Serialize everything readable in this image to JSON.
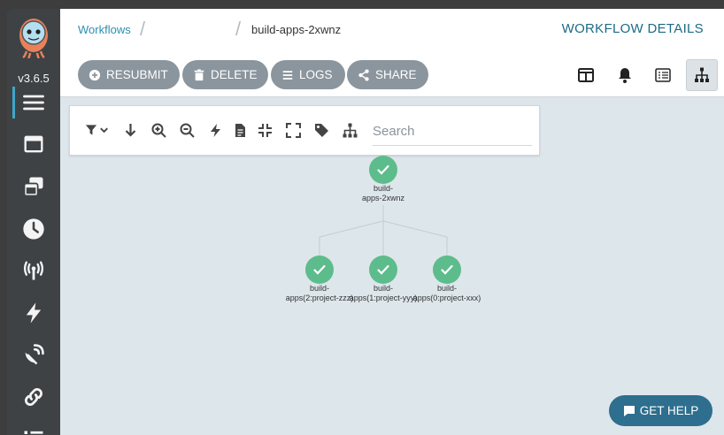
{
  "app": {
    "version": "v3.6.5",
    "brand_color": "#3fa7c9"
  },
  "sidebar": {
    "items": [
      {
        "icon": "menu-icon",
        "active": true
      },
      {
        "icon": "window-icon"
      },
      {
        "icon": "archive-stack-icon"
      },
      {
        "icon": "clock-icon"
      },
      {
        "icon": "antenna-icon"
      },
      {
        "icon": "bolt-icon"
      },
      {
        "icon": "satellite-icon"
      },
      {
        "icon": "link-icon"
      },
      {
        "icon": "list-icon"
      }
    ]
  },
  "header": {
    "breadcrumb_root": "Workflows",
    "breadcrumb_current": "build-apps-2xwnz",
    "title": "WORKFLOW DETAILS"
  },
  "actions": {
    "resubmit": "RESUBMIT",
    "delete": "DELETE",
    "logs": "LOGS",
    "share": "SHARE"
  },
  "views": [
    {
      "icon": "split-panel-icon"
    },
    {
      "icon": "bell-icon"
    },
    {
      "icon": "list-view-icon"
    },
    {
      "icon": "tree-view-icon",
      "active": true
    }
  ],
  "toolbar": {
    "tools": [
      "filter-icon",
      "download-arrow-icon",
      "zoom-in-icon",
      "zoom-out-icon",
      "bolt-icon",
      "document-icon",
      "collapse-icon",
      "expand-icon",
      "tag-icon",
      "hierarchy-icon"
    ],
    "search_placeholder": "Search"
  },
  "graph": {
    "root": {
      "label_1": "build-",
      "label_2": "apps-2xwnz",
      "status": "succeeded"
    },
    "children": [
      {
        "label_1": "build-",
        "label_2": "apps(2:project-zzz)",
        "status": "succeeded"
      },
      {
        "label_1": "build-",
        "label_2": "apps(1:project-yyy)",
        "status": "succeeded"
      },
      {
        "label_1": "build-",
        "label_2": "apps(0:project-xxx)",
        "status": "succeeded"
      }
    ],
    "success_color": "#5dbc8b"
  },
  "help": {
    "label": "GET HELP"
  }
}
